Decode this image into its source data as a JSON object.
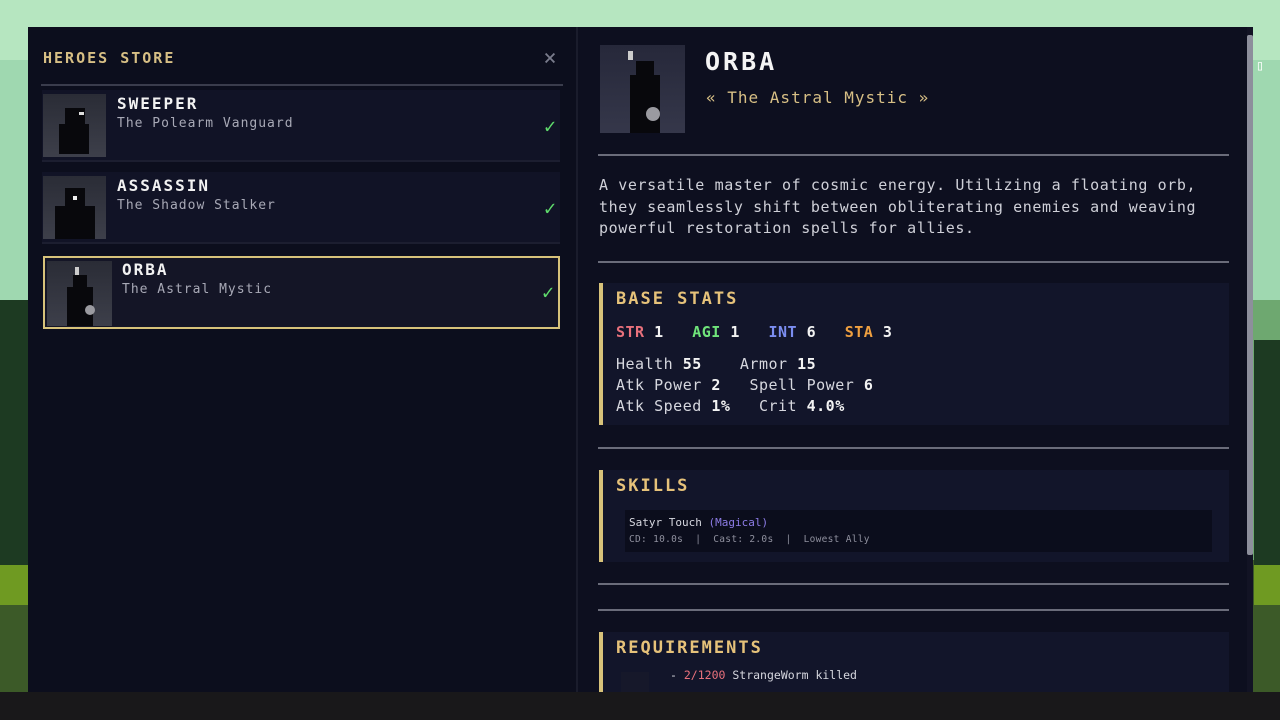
{
  "store": {
    "title": "HEROES STORE",
    "close_icon": "×"
  },
  "heroes": [
    {
      "name": "SWEEPER",
      "subtitle": "The Polearm Vanguard",
      "owned_mark": "✓"
    },
    {
      "name": "ASSASSIN",
      "subtitle": "The Shadow Stalker",
      "owned_mark": "✓"
    },
    {
      "name": "ORBA",
      "subtitle": "The Astral Mystic",
      "owned_mark": "✓"
    }
  ],
  "selected_hero": {
    "name": "ORBA",
    "subtitle": "« The Astral Mystic »",
    "description": "A versatile master of cosmic energy. Utilizing a floating orb, they seamlessly shift between obliterating enemies and weaving powerful restoration spells for allies."
  },
  "base_stats": {
    "title": "BASE STATS",
    "str_label": "STR",
    "str": "1",
    "agi_label": "AGI",
    "agi": "1",
    "int_label": "INT",
    "int": "6",
    "sta_label": "STA",
    "sta": "3",
    "health_label": "Health",
    "health": "55",
    "armor_label": "Armor",
    "armor": "15",
    "atk_power_label": "Atk Power",
    "atk_power": "2",
    "spell_power_label": "Spell Power",
    "spell_power": "6",
    "atk_speed_label": "Atk Speed",
    "atk_speed": "1%",
    "crit_label": "Crit",
    "crit": "4.0%"
  },
  "skills": {
    "title": "SKILLS",
    "items": [
      {
        "name": "Satyr Touch",
        "type": "(Magical)",
        "meta": "CD: 10.0s  |  Cast: 2.0s  |  Lowest Ally"
      }
    ]
  },
  "requirements": {
    "title": "REQUIREMENTS",
    "items": [
      {
        "dash": "-",
        "count": "2/1200",
        "text": "StrangeWorm killed"
      }
    ]
  },
  "colors": {
    "accent": "#d7c27a",
    "check": "#5fdc6c",
    "str": "#e9717c",
    "agi": "#6fe37a",
    "int": "#7b8df0",
    "sta": "#f0a040",
    "panel_bg": "#0d0f1f"
  },
  "icons": {
    "close": "close-icon",
    "check": "checkmark-icon",
    "corner": "menu-icon"
  }
}
